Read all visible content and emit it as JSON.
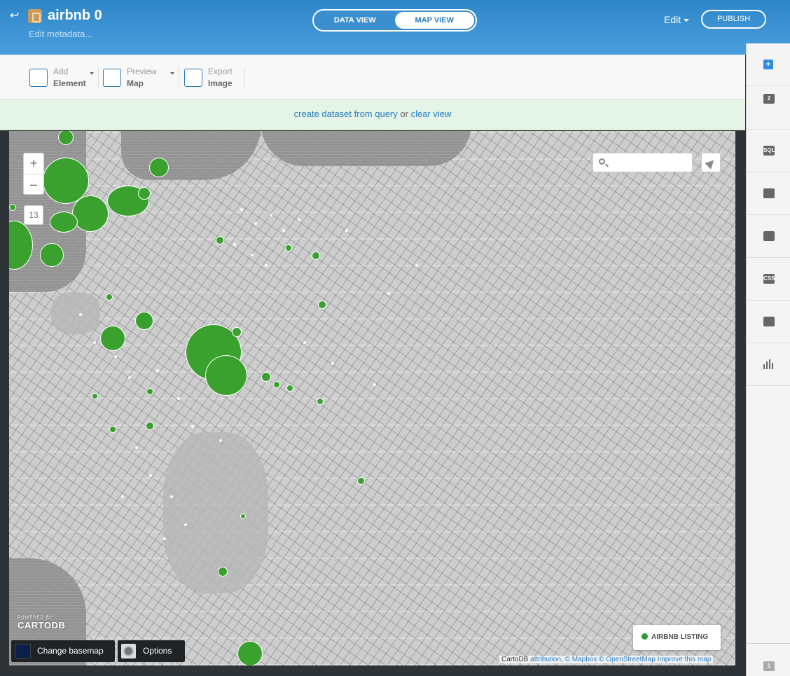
{
  "header": {
    "title": "airbnb 0",
    "edit_metadata": "Edit metadata...",
    "views": [
      "DATA VIEW",
      "MAP VIEW"
    ],
    "active_view": "MAP VIEW",
    "edit_label": "Edit",
    "publish_label": "PUBLISH"
  },
  "toolbar": {
    "add": {
      "line1": "Add",
      "line2": "Element"
    },
    "preview": {
      "line1": "Preview",
      "line2": "Map"
    },
    "export": {
      "line1": "Export",
      "line2": "Image"
    }
  },
  "infobar": {
    "link1": "create dataset from query",
    "or": "or",
    "link2": "clear view"
  },
  "map": {
    "zoom_in": "+",
    "zoom_out": "–",
    "zoom_level": "13",
    "search_placeholder": "",
    "logo_small": "POWERED BY",
    "logo": "CARTODB",
    "legend_label": "AIRBNB LISTING",
    "legend_color": "#2e9a2e",
    "basemap_label": "Change basemap",
    "options_label": "Options",
    "attribution": {
      "cartodb": "CartoDB",
      "attribution": "attribution",
      "mapbox": "© Mapbox",
      "osm": "© OpenStreetMap",
      "improve": "Improve this map"
    }
  },
  "rightbar": {
    "plus": "+",
    "items": [
      "2",
      "SQL",
      "wizard",
      "infowindow",
      "CSS",
      "legend",
      "chart"
    ],
    "bottom_badge": "1"
  }
}
